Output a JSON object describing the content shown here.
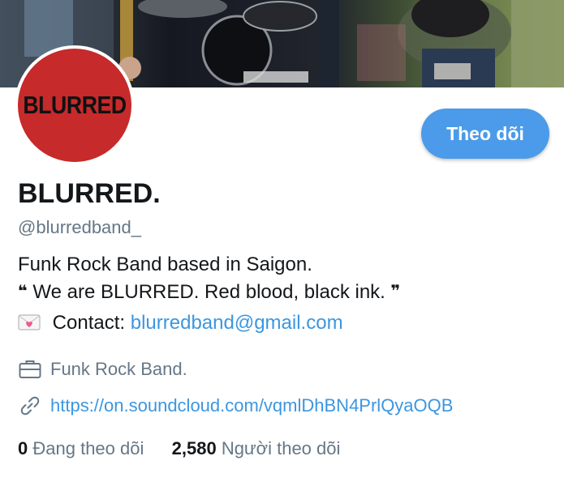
{
  "profile": {
    "avatar_text": "BLURRED",
    "follow_label": "Theo dõi",
    "display_name": "BLURRED.",
    "handle": "@blurredband_",
    "bio": {
      "line1": "Funk Rock Band based in Saigon.",
      "open_quote": "❝",
      "line2": "We are BLURRED. Red blood, black ink.",
      "close_quote": "❞",
      "contact_label": "Contact:",
      "contact_email": "blurredband@gmail.com"
    },
    "occupation": "Funk Rock Band.",
    "link": "https://on.soundcloud.com/vqmlDhBN4PrlQyaOQB",
    "following_count": "0",
    "following_label": "Đang theo dõi",
    "followers_count": "2,580",
    "followers_label": "Người theo dõi"
  },
  "icons": {
    "briefcase": "briefcase-icon",
    "link": "link-icon",
    "envelope": "envelope-heart-icon"
  },
  "colors": {
    "accent": "#4b9bea",
    "link": "#3c96e0",
    "secondary_text": "#657786",
    "avatar_bg": "#c62a2a"
  }
}
